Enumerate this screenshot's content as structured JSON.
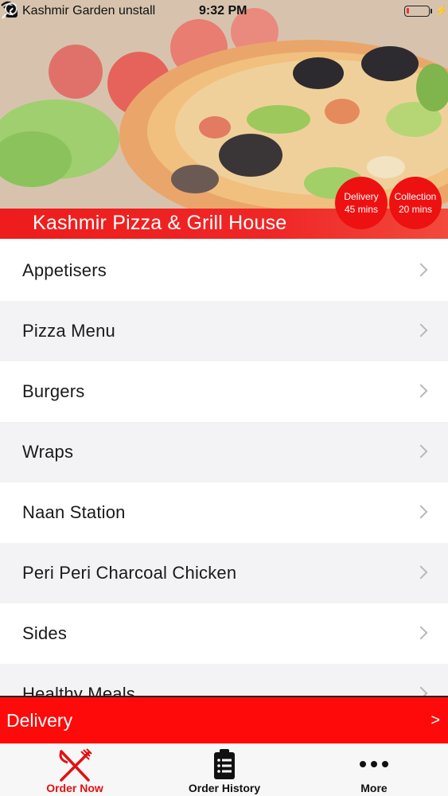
{
  "status_bar": {
    "app_name": "Kashmir Garden unstall",
    "time": "9:32 PM",
    "back_icon": "back-arrow-icon",
    "wifi_icon": "wifi-icon",
    "battery_icon": "battery-low-icon",
    "charging_icon": "lightning-bolt-icon"
  },
  "header": {
    "restaurant_name": "Kashmir Pizza & Grill House",
    "hero_image": "pizza-photo",
    "search_icon": "search-icon",
    "accent_color": "#ee1c1c"
  },
  "badges": {
    "delivery": {
      "title": "Delivery",
      "time": "45 mins"
    },
    "collection": {
      "title": "Collection",
      "time": "20 mins"
    }
  },
  "menu": {
    "items": [
      {
        "label": "Appetisers"
      },
      {
        "label": "Pizza Menu"
      },
      {
        "label": "Burgers"
      },
      {
        "label": "Wraps"
      },
      {
        "label": "Naan Station"
      },
      {
        "label": "Peri Peri Charcoal Chicken"
      },
      {
        "label": "Sides"
      },
      {
        "label": "Healthy Meals"
      }
    ],
    "chevron_icon": "chevron-right-icon"
  },
  "delivery_bar": {
    "label": "Delivery",
    "arrow": ">",
    "color": "#ff0a0a"
  },
  "tab_bar": {
    "tabs": [
      {
        "label": "Order Now",
        "icon": "fork-knife-icon",
        "active": true
      },
      {
        "label": "Order History",
        "icon": "clipboard-list-icon",
        "active": false
      },
      {
        "label": "More",
        "icon": "more-dots-icon",
        "active": false
      }
    ],
    "active_color": "#e31010"
  }
}
